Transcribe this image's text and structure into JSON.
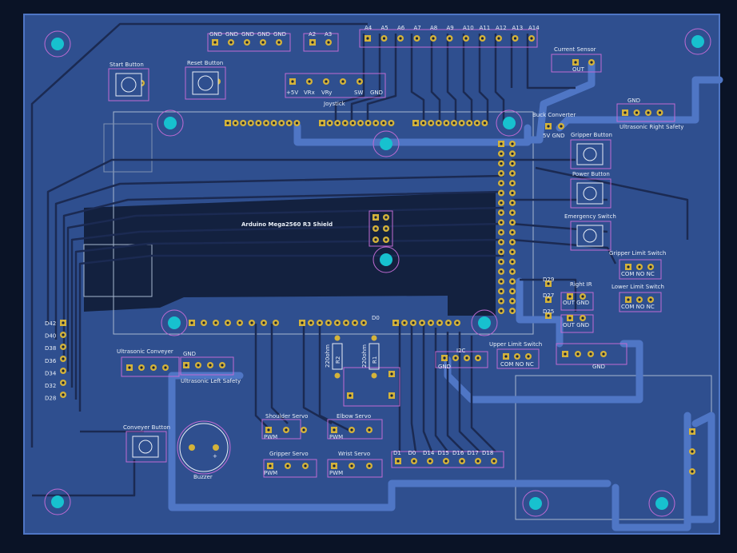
{
  "colors": {
    "background": "#0a1326",
    "board": "#2f4f8f",
    "trace": "#1b2a52",
    "trace_light": "#4f76c5",
    "pad": "#d4b33a",
    "mount_hole": "#17c1cf",
    "silkscreen": "#e8eef7",
    "fab_outline": "#a7b7cf",
    "courtyard": "#c06bd3"
  },
  "labels": {
    "arduino": "Arduino Mega2560 R3 Shield",
    "start_button": "Start Button",
    "reset_button": "Reset Button",
    "joystick": "Joystick",
    "current_sensor": "Current Sensor",
    "out": "OUT",
    "buck_converter": "Buck Converter",
    "buck_pins": "5V  GND",
    "gripper_button": "Gripper Button",
    "power_button": "Power Button",
    "emergency_switch": "Emergency Switch",
    "gripper_limit": "Gripper Limit Switch",
    "lower_limit": "Lower Limit Switch",
    "upper_limit": "Upper Limit Switch",
    "com_no_nc": "COM NO  NC",
    "right_ir": "Right IR",
    "out_gnd": "OUT GND",
    "ultrasonic_right": "Ultrasonic Right Safety",
    "ultrasonic_left": "Ultrasonic Left Safety",
    "ultrasonic_conveyer": "Ultrasonic Conveyer",
    "gnd": "GND",
    "conveyer_button": "Conveyer Button",
    "buzzer": "Buzzer",
    "shoulder_servo": "Shoulder Servo",
    "elbow_servo": "Elbow Servo",
    "gripper_servo": "Gripper Servo",
    "wrist_servo": "Wrist Servo",
    "pwm": "PWM",
    "i2c": "I2C",
    "d0": "D0",
    "r2_value": "220ohm",
    "r1_value": "220ohm",
    "r2": "R2",
    "r1": "R1",
    "joystick_pins": [
      "+5V",
      "VRx",
      "VRy",
      "SW",
      "GND"
    ],
    "gnd_header": [
      "GND",
      "GND",
      "GND",
      "GND",
      "GND"
    ],
    "a_small": [
      "A2",
      "A3"
    ],
    "a_pins": [
      "A4",
      "A5",
      "A6",
      "A7",
      "A8",
      "A9",
      "A10",
      "A11",
      "A12",
      "A13",
      "A14"
    ],
    "d_left": [
      "D42",
      "D40",
      "D38",
      "D36",
      "D34",
      "D32",
      "D28"
    ],
    "d_right": [
      "D29",
      "D27",
      "D25"
    ],
    "d_bottom": [
      "D1",
      "D0",
      "D14",
      "D15",
      "D16",
      "D17",
      "D18"
    ]
  }
}
